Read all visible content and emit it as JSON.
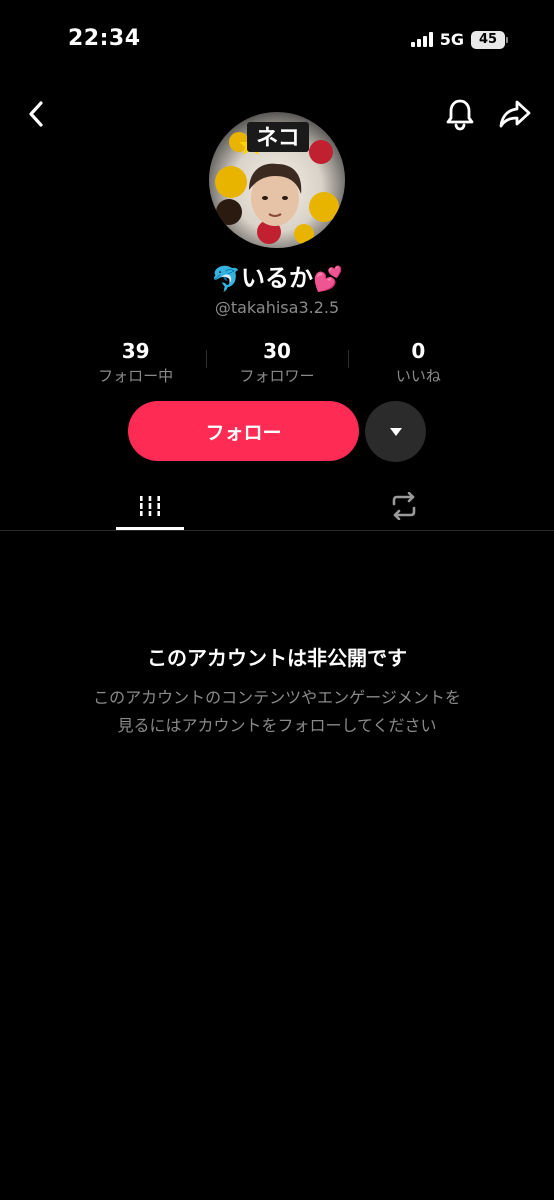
{
  "status_bar": {
    "time": "22:34",
    "network": "5G",
    "battery": "45"
  },
  "header": {
    "back_icon": "chevron-left-icon",
    "bell_icon": "bell-icon",
    "share_icon": "share-arrow-icon"
  },
  "profile": {
    "avatar_text": "ネコ",
    "display_name": "いるか",
    "display_name_emoji_left": "🐬",
    "display_name_emoji_right": "💕",
    "handle": "@takahisa3.2.5"
  },
  "stats": [
    {
      "value": "39",
      "label": "フォロー中"
    },
    {
      "value": "30",
      "label": "フォロワー"
    },
    {
      "value": "0",
      "label": "いいね"
    }
  ],
  "actions": {
    "follow_label": "フォロー",
    "more_icon": "caret-down-icon"
  },
  "tabs": [
    {
      "icon": "grid-icon",
      "active": true
    },
    {
      "icon": "repost-icon",
      "active": false
    }
  ],
  "private_notice": {
    "title": "このアカウントは非公開です",
    "line1": "このアカウントのコンテンツやエンゲージメントを",
    "line2": "見るにはアカウントをフォローしてください"
  },
  "colors": {
    "background": "#000000",
    "accent": "#fe2c55",
    "muted_text": "#8a8a8a"
  }
}
